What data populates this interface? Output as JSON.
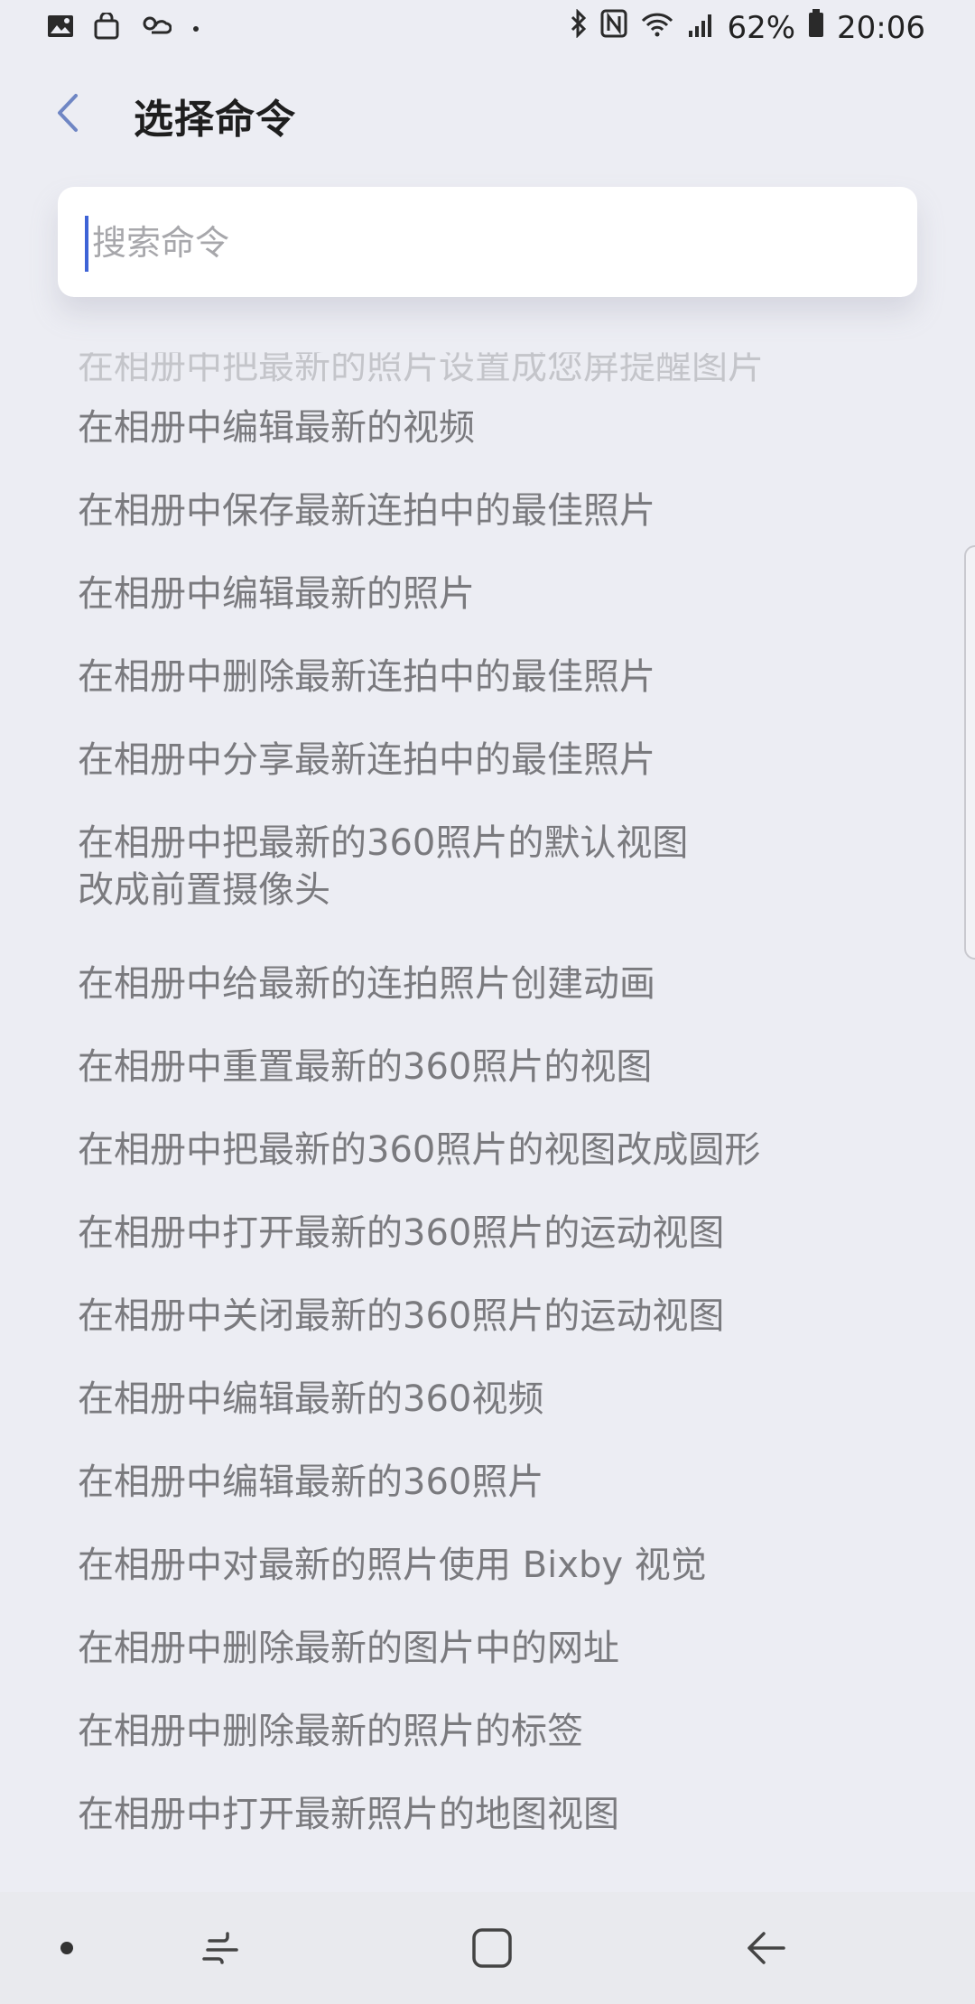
{
  "status_bar": {
    "battery": "62%",
    "time": "20:06",
    "left_icons": [
      "image-icon",
      "bag-icon",
      "weather-icon",
      "dot-icon"
    ],
    "right_icons": [
      "bluetooth-icon",
      "nfc-icon",
      "wifi-icon",
      "signal-icon",
      "battery-icon"
    ]
  },
  "header": {
    "title": "选择命令"
  },
  "search": {
    "placeholder": "搜索命令",
    "value": ""
  },
  "list": {
    "partial_item": "在相册中把最新的照片设置成您屏提醒图片",
    "items": [
      "在相册中编辑最新的视频",
      "在相册中保存最新连拍中的最佳照片",
      "在相册中编辑最新的照片",
      "在相册中删除最新连拍中的最佳照片",
      "在相册中分享最新连拍中的最佳照片",
      "在相册中把最新的360照片的默认视图改成前置摄像头",
      "在相册中给最新的连拍照片创建动画",
      "在相册中重置最新的360照片的视图",
      "在相册中把最新的360照片的视图改成圆形",
      "在相册中打开最新的360照片的运动视图",
      "在相册中关闭最新的360照片的运动视图",
      "在相册中编辑最新的360视频",
      "在相册中编辑最新的360照片",
      "在相册中对最新的照片使用 Bixby 视觉",
      "在相册中删除最新的图片中的网址",
      "在相册中删除最新的照片的标签",
      "在相册中打开最新照片的地图视图"
    ],
    "item6_line1": "在相册中把最新的360照片的默认视图",
    "item6_line2": "改成前置摄像头"
  },
  "nav": {
    "buttons": [
      "dot-button",
      "recents-button",
      "home-button",
      "back-button"
    ]
  },
  "colors": {
    "background": "#ECEDF3",
    "text": "#7A7A7E",
    "title": "#1E1E1E",
    "accent": "#3E63D6",
    "placeholder": "#A7A7AB"
  }
}
